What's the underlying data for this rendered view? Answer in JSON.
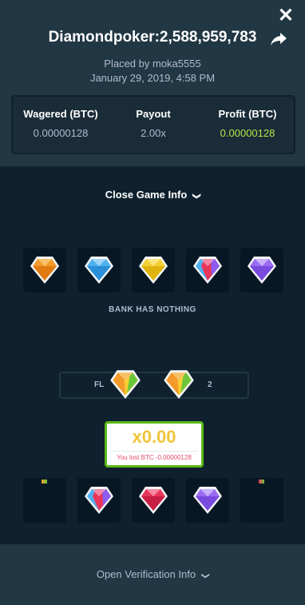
{
  "header": {
    "title": "Diamondpoker:2,588,959,783",
    "placed_by": "Placed by moka5555",
    "date": "January 29, 2019, 4:58 PM"
  },
  "stats": [
    {
      "label": "Wagered (BTC)",
      "value": "0.00000128"
    },
    {
      "label": "Payout",
      "value": "2.00x"
    },
    {
      "label": "Profit (BTC)",
      "value": "0.00000128"
    }
  ],
  "toggle_label": "Close Game Info",
  "dealer_gems": [
    "orange",
    "blue",
    "yellow",
    "rainbow",
    "purple"
  ],
  "bank_text": "BANK HAS NOTHING",
  "slot_labels": {
    "left": "FL",
    "right": "2"
  },
  "floating_gems": [
    "rainbow",
    "rainbow"
  ],
  "result": {
    "multiplier": "x0.00",
    "lost_text": "You lost BTC -0.00000128"
  },
  "player_gems": [
    "empty",
    "rainbow",
    "red",
    "purple",
    "empty"
  ],
  "verify_label": "Open Verification Info",
  "colors": {
    "profit_green": "#b4e44a",
    "panel": "#213743",
    "bg": "#0f212e",
    "result_border": "#5cb916"
  }
}
